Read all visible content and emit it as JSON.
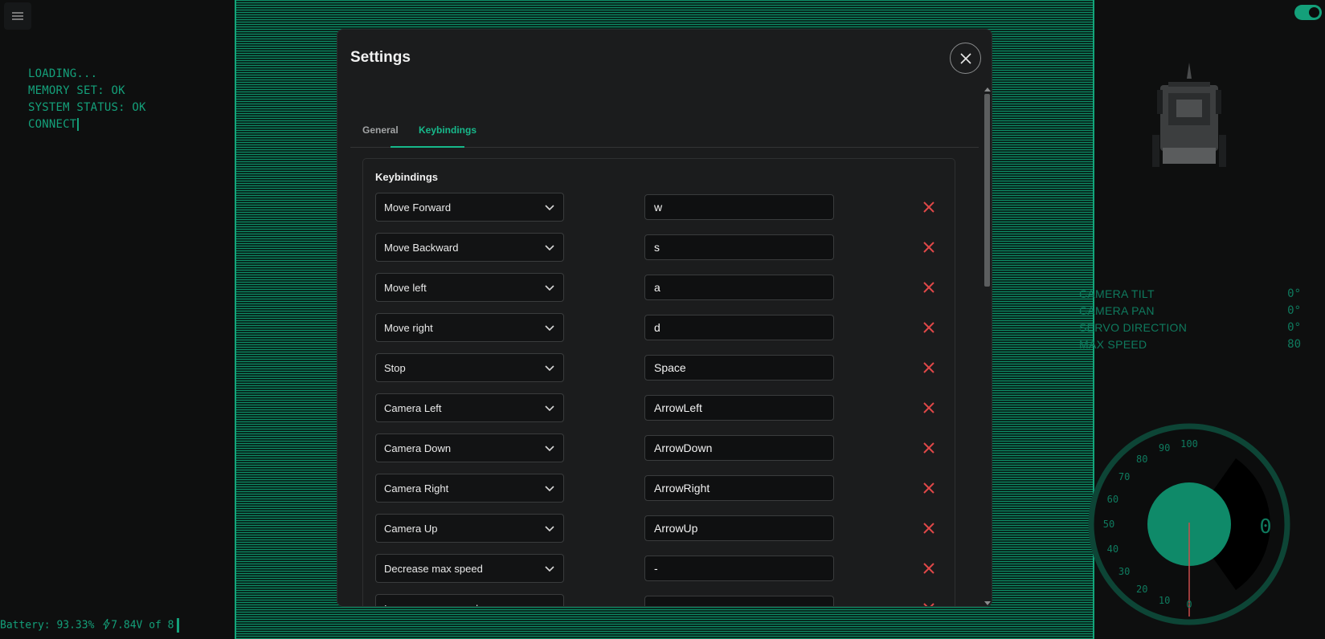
{
  "app": {
    "menu_icon": "hamburger-icon"
  },
  "boot_log": {
    "lines": [
      "LOADING...",
      "MEMORY SET: OK",
      "SYSTEM STATUS: OK",
      "CONNECT"
    ]
  },
  "battery": {
    "label": "Battery: 93.33%",
    "bolt_icon": "lightning-icon",
    "voltage": "7.84V of 8"
  },
  "telemetry": [
    {
      "label": "CAMERA TILT",
      "value": "0°"
    },
    {
      "label": "CAMERA PAN",
      "value": "0°"
    },
    {
      "label": "SERVO DIRECTION",
      "value": "0°"
    },
    {
      "label": "MAX SPEED",
      "value": "80"
    }
  ],
  "gauge": {
    "ticks": [
      "0",
      "10",
      "20",
      "30",
      "40",
      "50",
      "60",
      "70",
      "80",
      "90",
      "100"
    ],
    "value": "0",
    "max_speed": 80
  },
  "colors": {
    "accent": "#17b98b",
    "terminal": "#14a07a",
    "danger": "#e04848",
    "modal_bg": "#1b1c1d"
  },
  "settings": {
    "title": "Settings",
    "close_icon": "close-icon",
    "tabs": [
      {
        "label": "General",
        "active": false
      },
      {
        "label": "Keybindings",
        "active": true
      }
    ],
    "keybindings": {
      "title": "Keybindings",
      "rows": [
        {
          "action": "Move Forward",
          "key": "w"
        },
        {
          "action": "Move Backward",
          "key": "s"
        },
        {
          "action": "Move left",
          "key": "a"
        },
        {
          "action": "Move right",
          "key": "d"
        },
        {
          "action": "Stop",
          "key": "Space"
        },
        {
          "action": "Camera Left",
          "key": "ArrowLeft"
        },
        {
          "action": "Camera Down",
          "key": "ArrowDown"
        },
        {
          "action": "Camera Right",
          "key": "ArrowRight"
        },
        {
          "action": "Camera Up",
          "key": "ArrowUp"
        },
        {
          "action": "Decrease max speed",
          "key": "-"
        },
        {
          "action": "Increase max speed",
          "key": "="
        }
      ]
    }
  }
}
